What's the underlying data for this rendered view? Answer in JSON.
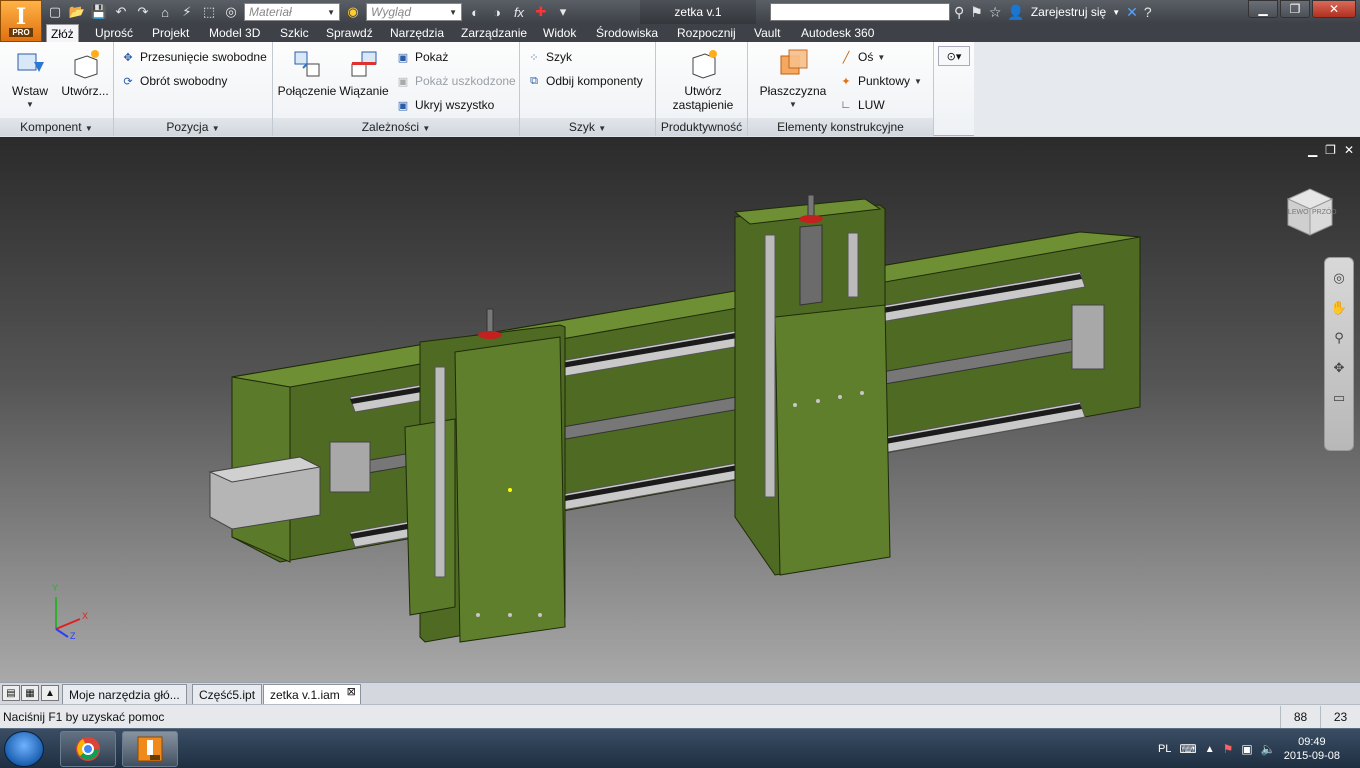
{
  "app": {
    "logo_letter": "I",
    "logo_badge": "PRO",
    "logo_color": "#f08a1c"
  },
  "title_bar": {
    "material_placeholder": "Materiał",
    "appearance_placeholder": "Wygląd",
    "document_title": "zetka v.1",
    "register_label": "Zarejestruj się",
    "window_controls": [
      "minimize-icon",
      "restore-icon",
      "close-icon"
    ]
  },
  "ribbon_tabs": [
    "Złóż",
    "Uprość",
    "Projekt",
    "Model 3D",
    "Szkic",
    "Sprawdź",
    "Narzędzia",
    "Zarządzanie",
    "Widok",
    "Środowiska",
    "Rozpocznij",
    "Vault",
    "Autodesk 360"
  ],
  "active_tab": "Złóż",
  "ribbon": {
    "komponent": {
      "label": "Komponent",
      "insert": "Wstaw",
      "create": "Utwórz..."
    },
    "pozycja": {
      "label": "Pozycja",
      "move": "Przesunięcie swobodne",
      "rotate": "Obrót swobodny"
    },
    "zaleznosci": {
      "label": "Zależności",
      "joint": "Połączenie",
      "constrain": "Wiązanie",
      "show": "Pokaż",
      "show_sick": "Pokaż uszkodzone",
      "hide_all": "Ukryj wszystko"
    },
    "szyk": {
      "label": "Szyk",
      "pattern": "Szyk",
      "mirror": "Odbij komponenty"
    },
    "produktywnosc": {
      "label": "Produktywność",
      "substitute_l1": "Utwórz",
      "substitute_l2": "zastąpienie"
    },
    "elementy": {
      "label": "Elementy konstrukcyjne",
      "plane": "Płaszczyzna",
      "axis": "Oś",
      "point": "Punktowy",
      "ucs": "LUW"
    }
  },
  "viewcube": {
    "face_left": "LEWO",
    "face_front": "PRZÓD"
  },
  "triad": {
    "x": "X",
    "y": "Y",
    "z": "Z"
  },
  "document_tabs": [
    "Moje narzędzia głó...",
    "Część5.ipt",
    "zetka v.1.iam"
  ],
  "active_document": "zetka v.1.iam",
  "status": {
    "help_text": "Naciśnij F1 by uzyskać pomoc",
    "count1": "88",
    "count2": "23"
  },
  "taskbar": {
    "language": "PL",
    "time": "09:49",
    "date": "2015-09-08"
  },
  "colors": {
    "model_green": "#5b7a2a",
    "ribbon_bg": "#f3f5f8",
    "title_bar": "#4a4e55"
  }
}
